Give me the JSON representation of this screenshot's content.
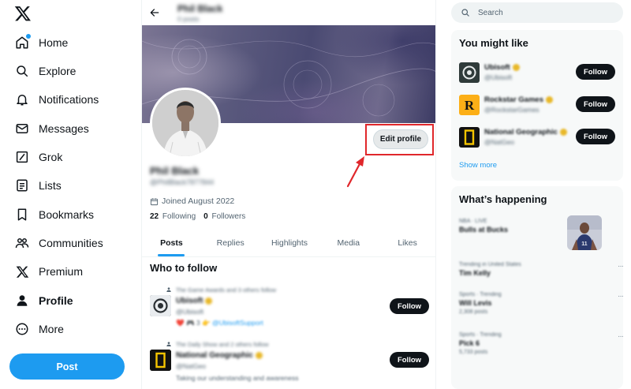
{
  "nav": {
    "items": [
      {
        "label": "Home",
        "icon": "home-icon"
      },
      {
        "label": "Explore",
        "icon": "search-icon"
      },
      {
        "label": "Notifications",
        "icon": "bell-icon"
      },
      {
        "label": "Messages",
        "icon": "envelope-icon"
      },
      {
        "label": "Grok",
        "icon": "grok-icon"
      },
      {
        "label": "Lists",
        "icon": "list-icon"
      },
      {
        "label": "Bookmarks",
        "icon": "bookmark-icon"
      },
      {
        "label": "Communities",
        "icon": "communities-icon"
      },
      {
        "label": "Premium",
        "icon": "x-logo-icon"
      },
      {
        "label": "Profile",
        "icon": "person-icon"
      },
      {
        "label": "More",
        "icon": "more-icon"
      }
    ],
    "post_label": "Post"
  },
  "profile": {
    "header_name": "Phil Black",
    "header_sub": "0 posts",
    "name": "Phil Black",
    "handle": "@PhilBlack7877844",
    "edit_label": "Edit profile",
    "joined": "Joined August 2022",
    "following_count": "22",
    "following_label": "Following",
    "followers_count": "0",
    "followers_label": "Followers",
    "tabs": [
      "Posts",
      "Replies",
      "Highlights",
      "Media",
      "Likes"
    ],
    "active_tab": "Posts"
  },
  "who_to_follow": {
    "title": "Who to follow",
    "items": [
      {
        "context": "The Game Awards and 3 others follow",
        "name": "Ubisoft",
        "handle": "@Ubisoft",
        "bio_prefix": "❤️ 🎮 3 👉",
        "bio_link": "@UbisoftSupport",
        "follow_label": "Follow"
      },
      {
        "context": "The Daily Show and 2 others follow",
        "name": "National Geographic",
        "handle": "@NatGeo",
        "bio_prefix": "Taking our understanding and awareness",
        "bio_link": "",
        "follow_label": "Follow"
      }
    ]
  },
  "search": {
    "placeholder": "Search"
  },
  "you_might_like": {
    "title": "You might like",
    "items": [
      {
        "name": "Ubisoft",
        "handle": "@Ubisoft",
        "follow_label": "Follow"
      },
      {
        "name": "Rockstar Games",
        "handle": "@RockstarGames",
        "follow_label": "Follow"
      },
      {
        "name": "National Geographic",
        "handle": "@NatGeo",
        "follow_label": "Follow"
      }
    ],
    "show_more": "Show more"
  },
  "whats_happening": {
    "title": "What’s happening",
    "trends": [
      {
        "meta": "NBA · LIVE",
        "title": "Bulls at Bucks",
        "count": ""
      },
      {
        "meta": "Trending in United States",
        "title": "Tim Kelly",
        "count": ""
      },
      {
        "meta": "Sports · Trending",
        "title": "Will Levis",
        "count": "2,308 posts"
      },
      {
        "meta": "Sports · Trending",
        "title": "Pick 6",
        "count": "5,733 posts"
      }
    ]
  },
  "colors": {
    "accent": "#1d9bf0",
    "highlight": "#e0272b",
    "text": "#0f1419",
    "muted": "#536471"
  }
}
